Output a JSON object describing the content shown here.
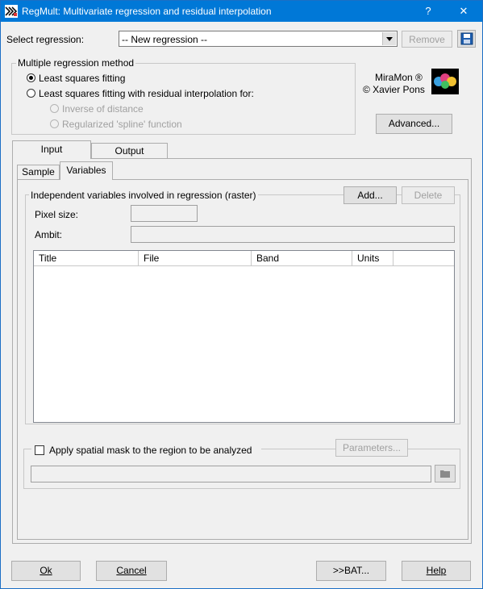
{
  "window": {
    "title": "RegMult: Multivariate regression and residual interpolation",
    "help_glyph": "?",
    "close_glyph": "✕",
    "title_bar_color": "#0078d7"
  },
  "select_regression": {
    "label": "Select regression:",
    "value": "-- New regression --",
    "remove_label": "Remove",
    "save_icon": "floppy-disk-icon"
  },
  "method": {
    "group_label": "Multiple regression method",
    "options": [
      {
        "label": "Least squares fitting",
        "selected": true,
        "enabled": true
      },
      {
        "label": "Least squares fitting with residual interpolation for:",
        "selected": false,
        "enabled": true
      }
    ],
    "sub_options": [
      {
        "label": "Inverse of distance",
        "enabled": false
      },
      {
        "label": "Regularized 'spline' function",
        "enabled": false
      }
    ]
  },
  "branding": {
    "line1": "MiraMon ®",
    "line2": "© Xavier Pons"
  },
  "advanced_label": "Advanced...",
  "tabs": {
    "main": [
      "Input",
      "Output"
    ],
    "sub": [
      "Sample",
      "Variables"
    ]
  },
  "variables": {
    "group_label": "Independent variables involved in regression (raster)",
    "add_label": "Add...",
    "delete_label": "Delete",
    "pixel_size_label": "Pixel size:",
    "pixel_size_value": "",
    "ambit_label": "Ambit:",
    "ambit_value": "",
    "columns": [
      "Title",
      "File",
      "Band",
      "Units"
    ],
    "rows": []
  },
  "mask": {
    "label": "Apply spatial mask to the region to be analyzed",
    "checked": false,
    "parameters_label": "Parameters...",
    "path_value": "",
    "browse_icon": "folder-icon"
  },
  "footer": {
    "ok_label": "Ok",
    "cancel_label": "Cancel",
    "bat_label": ">>BAT...",
    "help_label": "Help"
  }
}
